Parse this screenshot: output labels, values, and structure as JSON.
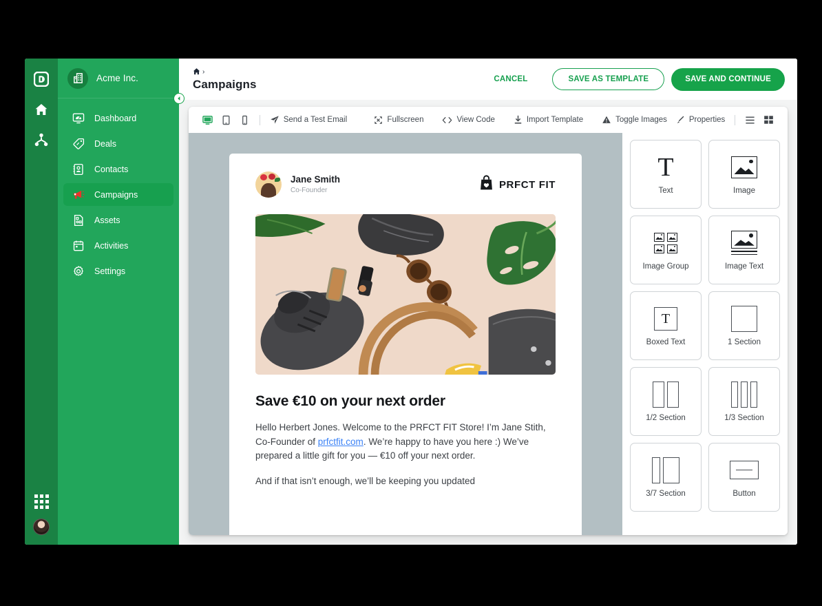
{
  "rail": {
    "logo_icon": "app-logo-icon",
    "items": [
      {
        "name": "home-icon"
      },
      {
        "name": "network-icon"
      }
    ],
    "apps_icon": "apps-grid-icon",
    "avatar": "user-avatar"
  },
  "sidebar": {
    "org_name": "Acme Inc.",
    "org_icon": "building-icon",
    "collapse_icon": "chevron-left-icon",
    "items": [
      {
        "label": "Dashboard",
        "icon": "dashboard-icon",
        "active": false
      },
      {
        "label": "Deals",
        "icon": "tag-icon",
        "active": false
      },
      {
        "label": "Contacts",
        "icon": "contacts-icon",
        "active": false
      },
      {
        "label": "Campaigns",
        "icon": "megaphone-icon",
        "active": true
      },
      {
        "label": "Assets",
        "icon": "assets-icon",
        "active": false
      },
      {
        "label": "Activities",
        "icon": "calendar-icon",
        "active": false
      },
      {
        "label": "Settings",
        "icon": "gear-icon",
        "active": false
      }
    ]
  },
  "topbar": {
    "breadcrumb_home_icon": "home-icon",
    "breadcrumb_separator": "›",
    "page_title": "Campaigns",
    "cancel_label": "CANCEL",
    "save_template_label": "SAVE AS TEMPLATE",
    "save_continue_label": "SAVE AND CONTINUE"
  },
  "editor_toolbar": {
    "devices": [
      {
        "name": "desktop-view-icon",
        "active": true
      },
      {
        "name": "tablet-view-icon",
        "active": false
      },
      {
        "name": "mobile-view-icon",
        "active": false
      }
    ],
    "actions": [
      {
        "label": "Send a Test Email",
        "icon": "paper-plane-icon"
      },
      {
        "label": "Fullscreen",
        "icon": "fullscreen-icon"
      },
      {
        "label": "View Code",
        "icon": "code-brackets-icon"
      },
      {
        "label": "Import Template",
        "icon": "download-icon"
      },
      {
        "label": "Toggle Images",
        "icon": "image-triangle-icon"
      },
      {
        "label": "Properties",
        "icon": "brush-icon"
      }
    ],
    "view_list_icon": "list-view-icon",
    "view_grid_icon": "grid-view-icon"
  },
  "email": {
    "sender_name": "Jane Smith",
    "sender_role": "Co-Founder",
    "brand_name": "PRFCT FIT",
    "brand_icon": "shopping-bag-heart-icon",
    "headline": "Save €10 on your next order",
    "paragraph_1_before_link": "Hello Herbert Jones. Welcome to the PRFCT FIT Store! I’m Jane Stith, Co-Founder of ",
    "paragraph_1_link": "prfctfit.com",
    "paragraph_1_after_link": ". We’re happy to have you here :) We’ve prepared  a little gift for you — €10 off your next order.",
    "paragraph_2": "And if that isn’t enough, we’ll be keeping you updated"
  },
  "blocks": [
    {
      "label": "Text",
      "glyph": "serif-T-icon"
    },
    {
      "label": "Image",
      "glyph": "image-icon"
    },
    {
      "label": "Image Group",
      "glyph": "image-group-icon"
    },
    {
      "label": "Image Text",
      "glyph": "image-text-icon"
    },
    {
      "label": "Boxed Text",
      "glyph": "boxed-text-icon"
    },
    {
      "label": "1 Section",
      "glyph": "one-section-icon"
    },
    {
      "label": "1/2 Section",
      "glyph": "half-section-icon"
    },
    {
      "label": "1/3 Section",
      "glyph": "third-section-icon"
    },
    {
      "label": "3/7 Section",
      "glyph": "three-seven-section-icon"
    },
    {
      "label": "Button",
      "glyph": "button-icon"
    }
  ],
  "colors": {
    "brand_green": "#16a34a",
    "sidebar_green": "#22a65b",
    "rail_green": "#1a8244",
    "active_nav": "#17a04f",
    "preview_bg": "#b3bfc3",
    "link_blue": "#3b82f6"
  }
}
